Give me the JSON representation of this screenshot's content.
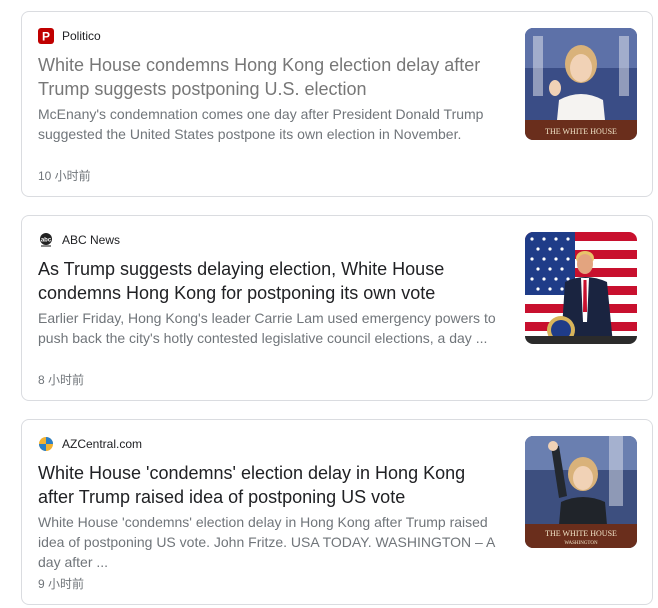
{
  "articles": [
    {
      "source": "Politico",
      "favicon": "politico-logo-icon",
      "title": "White House condemns Hong Kong election delay after Trump suggests postponing U.S. election",
      "snippet": "McEnany's condemnation comes one day after President Donald Trump suggested the United States postpone its own election in November.",
      "time": "10 小时前",
      "thumb_caption": "THE WHITE HOUSE",
      "thumb_subcaption": ""
    },
    {
      "source": "ABC News",
      "favicon": "abc-news-logo-icon",
      "title": "As Trump suggests delaying election, White House condemns Hong Kong for postponing its own vote",
      "snippet": "Earlier Friday, Hong Kong's leader Carrie Lam used emergency powers to push back the city's hotly contested legislative council elections, a day ...",
      "time": "8 小时前"
    },
    {
      "source": "AZCentral.com",
      "favicon": "azcentral-logo-icon",
      "title": "White House 'condemns' election delay in Hong Kong after Trump raised idea of postponing US vote",
      "snippet": "White House 'condemns' election delay in Hong Kong after Trump raised idea of postponing US vote. John Fritze. USA TODAY. WASHINGTON – A day after ...",
      "time": "9 小时前",
      "thumb_caption": "THE WHITE HOUSE",
      "thumb_subcaption": "WASHINGTON"
    }
  ],
  "colors": {
    "title_gray": "#777777",
    "snippet": "#70757a",
    "politico_red": "#c00000",
    "border": "#dadce0"
  }
}
